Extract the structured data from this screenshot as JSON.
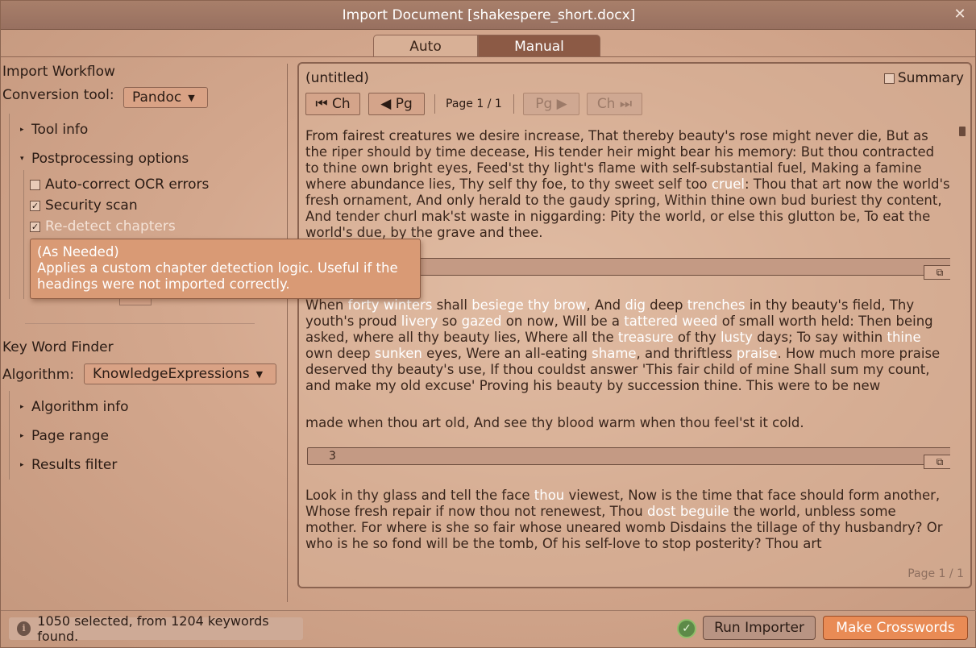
{
  "window": {
    "title": "Import Document [shakespere_short.docx]",
    "close_glyph": "✕"
  },
  "tabs": [
    {
      "label": "Auto",
      "active": false
    },
    {
      "label": "Manual",
      "active": true
    }
  ],
  "import_workflow": {
    "title": "Import Workflow",
    "conversion_label": "Conversion tool:",
    "conversion_value": "Pandoc",
    "tool_info": "Tool info",
    "postprocessing": "Postprocessing options",
    "options": [
      {
        "label": "Auto-correct OCR errors",
        "checked": false
      },
      {
        "label": "Security scan",
        "checked": true
      },
      {
        "label": "Re-detect chapters",
        "checked": true
      }
    ]
  },
  "tooltip": {
    "title": "(As Needed)",
    "body": "Applies a custom chapter detection logic. Useful if the headings were not imported correctly."
  },
  "keyword_finder": {
    "title": "Key Word Finder",
    "algorithm_label": "Algorithm:",
    "algorithm_value": "KnowledgeExpressions",
    "items": [
      "Algorithm info",
      "Page range",
      "Results filter"
    ]
  },
  "document": {
    "title": "(untitled)",
    "summary_label": "Summary",
    "nav": {
      "prev_ch": "⏮ Ch",
      "prev_pg": "◀ Pg",
      "page_info": "Page 1 / 1",
      "next_pg": "Pg ▶",
      "next_ch": "Ch ⏭"
    },
    "chapter_3_label": "3",
    "copy_glyph": "⧉",
    "footer": "Page 1 / 1"
  },
  "status": {
    "text": "1050 selected, from 1204 keywords found.",
    "info_glyph": "i",
    "ok_glyph": "✓"
  },
  "buttons": {
    "run": "Run Importer",
    "make": "Make Crosswords"
  },
  "colors": {
    "accent": "#e98b55",
    "highlight": "#ffffff",
    "ok": "#5d8a48"
  }
}
